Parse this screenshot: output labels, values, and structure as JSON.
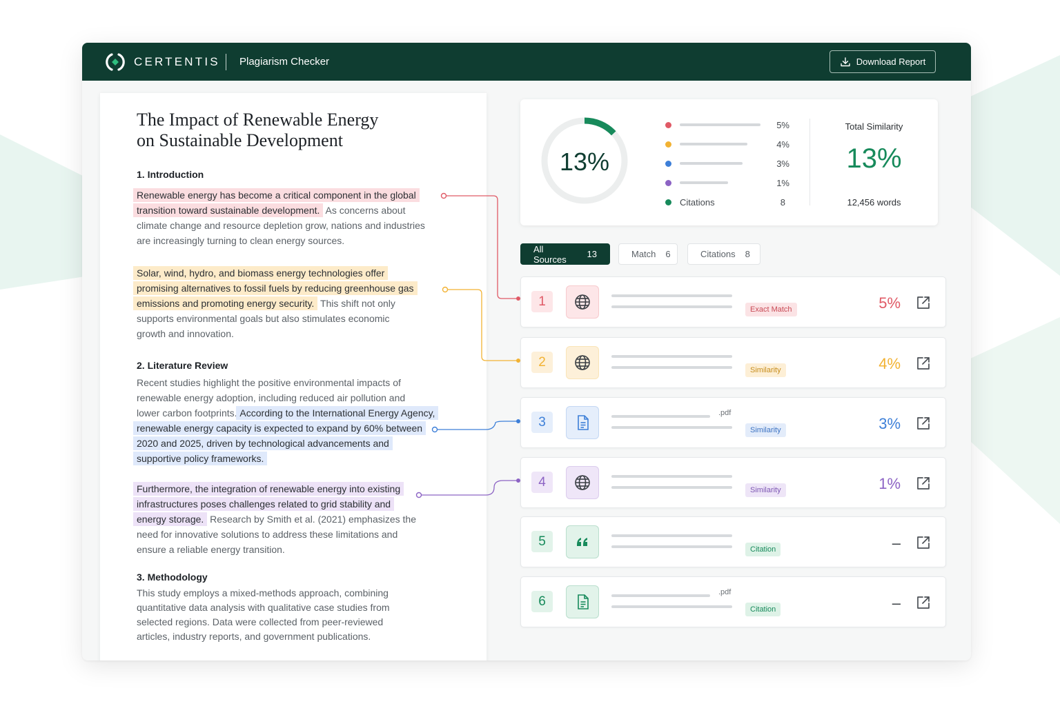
{
  "app": {
    "brand": "CERTENTIS",
    "title": "Plagiarism Checker",
    "download_label": "Download Report"
  },
  "colors": {
    "header": "#0f3d31",
    "red": "#e05a66",
    "orange": "#f2b233",
    "blue": "#3d7fd8",
    "purple": "#8c63c4",
    "green": "#178a5b"
  },
  "document": {
    "title_line1": "The Impact of Renewable Energy",
    "title_line2": "on Sustainable Development",
    "section1": "1. Introduction",
    "section2": "2. Literature Review",
    "section3": "3. Methodology",
    "p1": {
      "l1": "Renewable energy has become a critical component in the global",
      "l2_hl": "transition toward sustainable development.",
      "l2_rest": " As concerns about",
      "l3": "climate change and resource depletion grow, nations and industries",
      "l4": "are increasingly turning to clean energy sources."
    },
    "p2": {
      "l1": "Solar, wind, hydro, and biomass energy technologies offer",
      "l2": "promising alternatives to fossil fuels by reducing greenhouse gas",
      "l3_hl": "emissions and promoting energy security.",
      "l3_rest": " This shift not only",
      "l4": "supports environmental goals but also stimulates economic",
      "l5": "growth and innovation."
    },
    "p3": {
      "l1": "Recent studies highlight the positive environmental impacts of",
      "l2": "renewable energy adoption, including reduced air pollution and",
      "l3_plain": "lower carbon footprints.",
      "l3_hl": "According to the International Energy Agency,",
      "l4": "renewable energy capacity is expected to expand by 60% between",
      "l5": "2020 and 2025, driven by technological advancements and",
      "l6": "supportive policy frameworks."
    },
    "p4": {
      "l1": "Furthermore, the integration of renewable energy into existing",
      "l2": "infrastructures poses challenges related to grid stability and",
      "l3_hl": "energy storage.",
      "l3_rest": " Research by Smith et al. (2021) emphasizes the",
      "l4": "need for innovative solutions to address these limitations and",
      "l5": "ensure a reliable energy transition."
    },
    "p5": {
      "l1": "This study employs a mixed-methods approach, combining",
      "l2": "quantitative data analysis with qualitative case studies from",
      "l3": "selected regions. Data were collected from peer-reviewed",
      "l4": "articles, industry reports, and government publications."
    }
  },
  "summary": {
    "donut_label": "13%",
    "donut_fraction": 0.13,
    "legend": [
      {
        "pct": "5%",
        "color": "#e05a66",
        "bar_fraction": 1.0
      },
      {
        "pct": "4%",
        "color": "#f2b233",
        "bar_fraction": 0.84
      },
      {
        "pct": "3%",
        "color": "#3d7fd8",
        "bar_fraction": 0.78
      },
      {
        "pct": "1%",
        "color": "#8c63c4",
        "bar_fraction": 0.6
      }
    ],
    "citations_label": "Citations",
    "citations_count": "8",
    "total_label": "Total Similarity",
    "total_pct": "13%",
    "words": "12,456 words"
  },
  "tabs": [
    {
      "label": "All Sources",
      "count": "13"
    },
    {
      "label": "Match",
      "count": "6"
    },
    {
      "label": "Citations",
      "count": "8"
    }
  ],
  "sources": [
    {
      "num": "1",
      "icon": "globe-icon",
      "ext": "",
      "tag": "Exact Match",
      "pct": "5%",
      "color": "#e05a66",
      "tint": "#fde6e8",
      "tag_bg": "#fbe3e5",
      "tag_fg": "#c84a55"
    },
    {
      "num": "2",
      "icon": "globe-icon",
      "ext": "",
      "tag": "Similarity",
      "pct": "4%",
      "color": "#f2b233",
      "tint": "#fdf0d9",
      "tag_bg": "#fdefd6",
      "tag_fg": "#c68c1a"
    },
    {
      "num": "3",
      "icon": "document-icon",
      "ext": ".pdf",
      "tag": "Similarity",
      "pct": "3%",
      "color": "#3d7fd8",
      "tint": "#e5eefb",
      "tag_bg": "#e3ecfa",
      "tag_fg": "#3c72c2"
    },
    {
      "num": "4",
      "icon": "globe-icon",
      "ext": "",
      "tag": "Similarity",
      "pct": "1%",
      "color": "#8c63c4",
      "tint": "#efe6f8",
      "tag_bg": "#eee5f7",
      "tag_fg": "#7c56b3"
    },
    {
      "num": "5",
      "icon": "quote-icon",
      "ext": "",
      "tag": "Citation",
      "pct": "–",
      "color": "#178a5b",
      "tint": "#e2f3ea",
      "tag_bg": "#def2e7",
      "tag_fg": "#178a5b"
    },
    {
      "num": "6",
      "icon": "document-icon",
      "ext": ".pdf",
      "tag": "Citation",
      "pct": "–",
      "color": "#178a5b",
      "tint": "#e2f3ea",
      "tag_bg": "#def2e7",
      "tag_fg": "#178a5b"
    }
  ]
}
